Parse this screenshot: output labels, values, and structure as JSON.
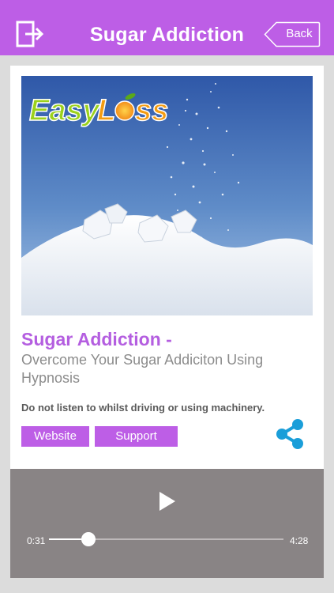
{
  "header": {
    "title": "Sugar Addiction",
    "back_label": "Back"
  },
  "hero": {
    "logo_text": "EasyLoss",
    "description_icon": "sugar-pile-image"
  },
  "content": {
    "title": "Sugar Addiction -",
    "subtitle": "Overcome Your Sugar Addiciton Using Hypnosis",
    "warning": "Do not listen to whilst driving or using machinery."
  },
  "buttons": {
    "website": "Website",
    "support": "Support"
  },
  "player": {
    "elapsed": "0:31",
    "total": "4:28",
    "progress": 0.167
  },
  "colors": {
    "accent": "#bd5ee6",
    "share": "#1a9ed9",
    "player_bg": "#898485"
  }
}
